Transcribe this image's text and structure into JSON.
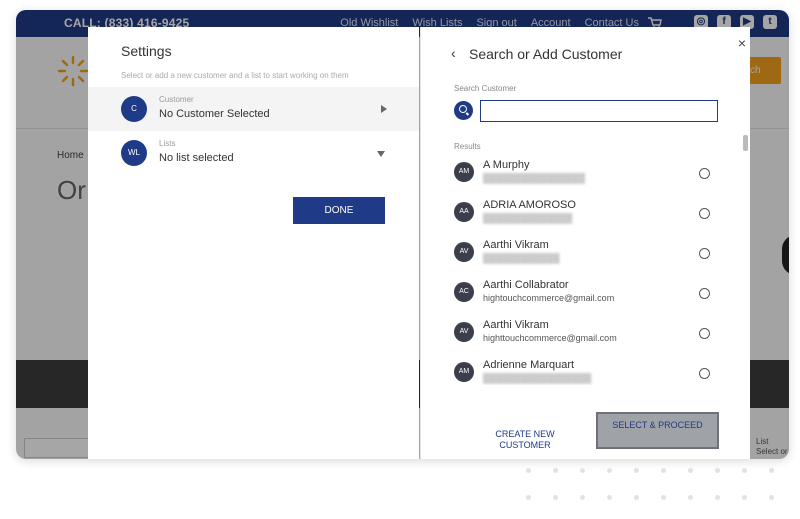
{
  "top_bar": {
    "call": "CALL: (833) 416-9425",
    "nav": [
      "Old Wishlist",
      "Wish Lists",
      "Sign out",
      "Account",
      "Contact Us"
    ]
  },
  "background_page": {
    "breadcrumb": "Home",
    "heading_partial": "Or",
    "orange_button_partial": "ch",
    "side_list_label": "List",
    "side_list_select": "Select or"
  },
  "settings": {
    "title": "Settings",
    "subtitle": "Select or add a new customer and a list to start working on them",
    "customer": {
      "avatar": "C",
      "caption": "Customer",
      "value": "No Customer Selected"
    },
    "lists": {
      "avatar": "WL",
      "caption": "Lists",
      "value": "No list selected"
    },
    "done_label": "DONE"
  },
  "search_panel": {
    "title": "Search or Add Customer",
    "search_label": "Search Customer",
    "search_value": "",
    "results_label": "Results",
    "results": [
      {
        "initials": "AM",
        "name": "A Murphy",
        "email": "",
        "email_blurred": true
      },
      {
        "initials": "AA",
        "name": "ADRIA AMOROSO",
        "email": "",
        "email_blurred": true
      },
      {
        "initials": "AV",
        "name": "Aarthi Vikram",
        "email": "",
        "email_blurred": true
      },
      {
        "initials": "AC",
        "name": "Aarthi Collabrator",
        "email": "hightouchcommerce@gmail.com",
        "email_blurred": false
      },
      {
        "initials": "AV",
        "name": "Aarthi Vikram",
        "email": "highttouchcommerce@gmail.com",
        "email_blurred": false
      },
      {
        "initials": "AM",
        "name": "Adrienne Marquart",
        "email": "",
        "email_blurred": true
      }
    ],
    "create_label": "CREATE NEW CUSTOMER",
    "select_label": "SELECT & PROCEED",
    "close_glyph": "×",
    "back_glyph": "‹"
  },
  "colors": {
    "brand_blue": "#1f3a86",
    "accent_orange": "#f3a21c",
    "disabled_button": "#9fa2a7"
  },
  "icons": [
    "cart-icon",
    "instagram-icon",
    "facebook-icon",
    "youtube-icon",
    "twitter-icon",
    "search-icon",
    "close-icon",
    "back-chevron-icon"
  ]
}
